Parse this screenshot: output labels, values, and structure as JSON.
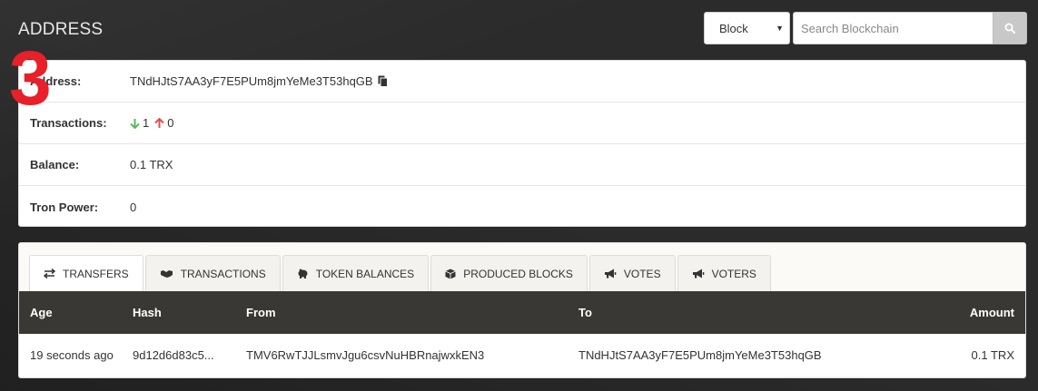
{
  "page": {
    "title": "ADDRESS",
    "step_number": "3"
  },
  "search": {
    "select_value": "Block",
    "placeholder": "Search Blockchain",
    "icon": "search-icon"
  },
  "address_info": {
    "address_label": "Address:",
    "address_value": "TNdHJtS7AA3yF7E5PUm8jmYeMe3T53hqGB",
    "transactions_label": "Transactions:",
    "tx_in": "1",
    "tx_out": "0",
    "balance_label": "Balance:",
    "balance_value": "0.1 TRX",
    "tron_power_label": "Tron Power:",
    "tron_power_value": "0"
  },
  "colors": {
    "in_arrow": "#5cb85c",
    "out_arrow": "#d9534f",
    "table_header_bg": "#3a3835"
  },
  "tabs": [
    {
      "label": "TRANSFERS",
      "icon": "exchange-icon",
      "active": true
    },
    {
      "label": "TRANSACTIONS",
      "icon": "handshake-icon",
      "active": false
    },
    {
      "label": "TOKEN BALANCES",
      "icon": "piggy-bank-icon",
      "active": false
    },
    {
      "label": "PRODUCED BLOCKS",
      "icon": "cube-icon",
      "active": false
    },
    {
      "label": "VOTES",
      "icon": "bullhorn-icon",
      "active": false
    },
    {
      "label": "VOTERS",
      "icon": "bullhorn-icon",
      "active": false
    }
  ],
  "table": {
    "headers": {
      "age": "Age",
      "hash": "Hash",
      "from": "From",
      "to": "To",
      "amount": "Amount"
    },
    "rows": [
      {
        "age": "19 seconds ago",
        "hash": "9d12d6d83c5...",
        "from": "TMV6RwTJJLsmvJgu6csvNuHBRnajwxkEN3",
        "to": "TNdHJtS7AA3yF7E5PUm8jmYeMe3T53hqGB",
        "amount": "0.1 TRX"
      }
    ]
  }
}
